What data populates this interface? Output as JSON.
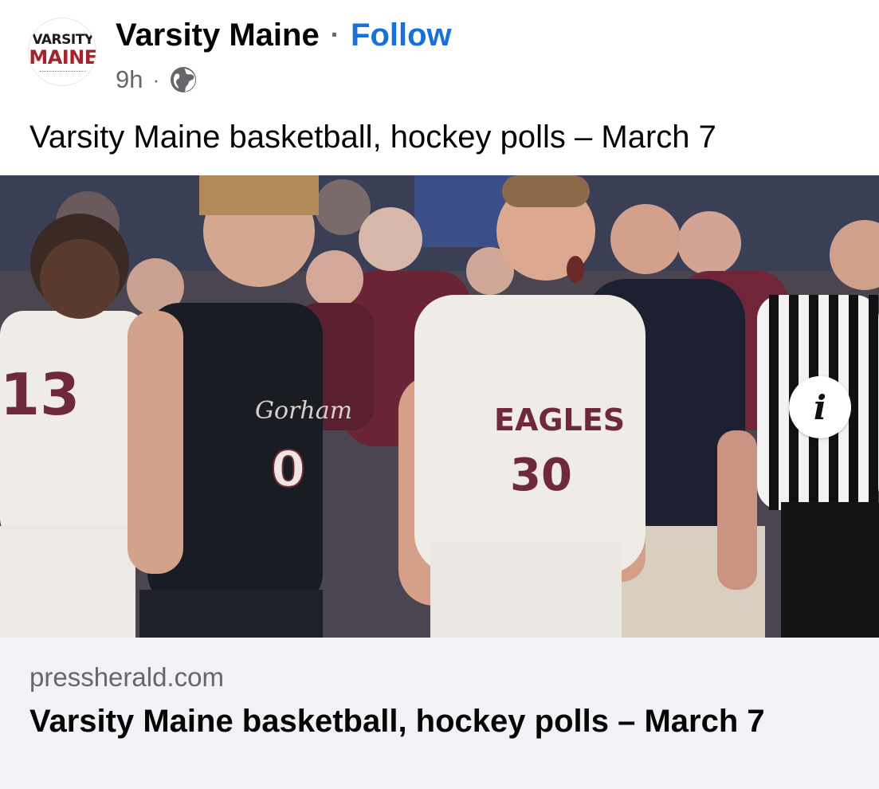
{
  "post": {
    "page_name": "Varsity Maine",
    "follow_label": "Follow",
    "separator": "·",
    "time": "9h",
    "caption": "Varsity Maine basketball, hockey polls – March 7",
    "avatar": {
      "logo_top": "VARSITY",
      "logo_bottom": "MAINE",
      "icon": "varsity-maine-logo"
    },
    "audience_icon": "globe-icon"
  },
  "photo": {
    "jerseys": {
      "left_player_number": "13",
      "dark_player_team": "Gorham",
      "dark_player_number": "0",
      "center_player_team": "EAGLES",
      "center_player_number": "30"
    },
    "info_icon": "info-icon",
    "info_symbol": "i"
  },
  "link_preview": {
    "domain": "pressherald.com",
    "title": "Varsity Maine basketball, hockey polls – March 7"
  },
  "colors": {
    "follow_blue": "#1b6fd8",
    "secondary_text": "#65676b",
    "link_background": "#f0f2f5",
    "maroon": "#6e2a3a"
  }
}
